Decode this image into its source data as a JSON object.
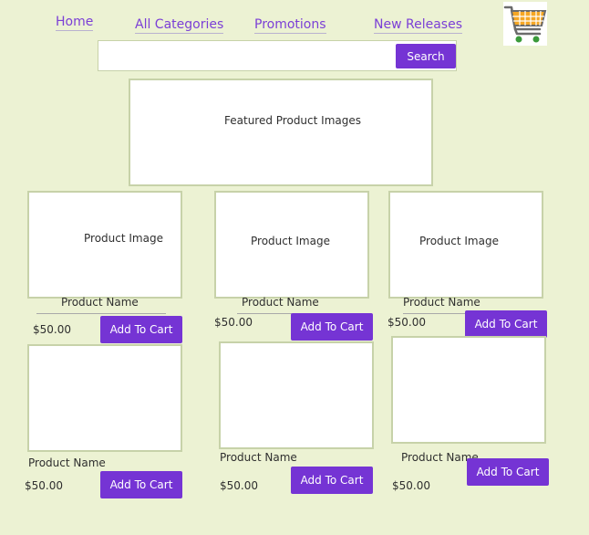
{
  "nav": {
    "home": "Home",
    "all_categories": "All Categories",
    "promotions": "Promotions",
    "new_releases": "New Releases"
  },
  "search": {
    "value": "",
    "button": "Search"
  },
  "featured": {
    "label": "Featured Product Images"
  },
  "products": [
    {
      "image_label": "Product Image",
      "name": "Product Name",
      "price": "$50.00",
      "button": "Add To Cart"
    },
    {
      "image_label": "Product Image",
      "name": "Product Name",
      "price": "$50.00",
      "button": "Add To Cart"
    },
    {
      "image_label": "Product Image",
      "name": "Product Name",
      "price": "$50.00",
      "button": "Add To Cart"
    },
    {
      "image_label": "",
      "name": "Product Name",
      "price": "$50.00",
      "button": "Add To Cart"
    },
    {
      "image_label": "",
      "name": "Product Name",
      "price": "$50.00",
      "button": "Add To Cart"
    },
    {
      "image_label": "",
      "name": "Product Name",
      "price": "$50.00",
      "button": "Add To Cart"
    }
  ],
  "icons": {
    "cart": "shopping-cart-icon"
  },
  "colors": {
    "accent": "#7534d4",
    "background": "#ecf2d3",
    "link": "#7b3fd6"
  }
}
